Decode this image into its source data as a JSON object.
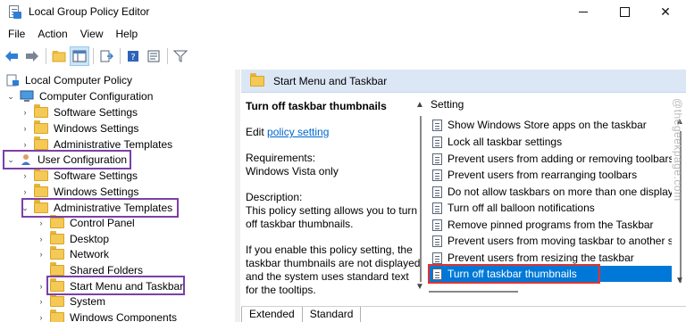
{
  "window": {
    "title": "Local Group Policy Editor",
    "icons": {
      "app": "group-policy-icon",
      "minimize": "minimize-icon",
      "maximize": "maximize-icon",
      "close": "close-icon"
    },
    "close_glyph": "✕"
  },
  "menu": [
    "File",
    "Action",
    "View",
    "Help"
  ],
  "toolbar": {
    "buttons": [
      "back-arrow-icon",
      "forward-arrow-icon",
      "folder-up-icon",
      "show-hide-tree-icon",
      "export-list-icon",
      "help-icon",
      "properties-icon",
      "filter-icon"
    ]
  },
  "tree": {
    "root": "Local Computer Policy",
    "computer_configuration": "Computer Configuration",
    "cc_software": "Software Settings",
    "cc_windows": "Windows Settings",
    "cc_admin": "Administrative Templates",
    "user_configuration": "User Configuration",
    "uc_software": "Software Settings",
    "uc_windows": "Windows Settings",
    "uc_admin": "Administrative Templates",
    "control_panel": "Control Panel",
    "desktop": "Desktop",
    "network": "Network",
    "shared_folders": "Shared Folders",
    "start_menu": "Start Menu and Taskbar",
    "system": "System",
    "windows_components": "Windows Components"
  },
  "right_pane": {
    "header": "Start Menu and Taskbar",
    "policy_title": "Turn off taskbar thumbnails",
    "edit_prefix": "Edit",
    "edit_link": "policy setting",
    "requirements_label": "Requirements:",
    "requirements_value": "Windows Vista only",
    "description_label": "Description:",
    "description_1": "This policy setting allows you to turn off taskbar thumbnails.",
    "description_2": "If you enable this policy setting, the taskbar thumbnails are not displayed and the system uses standard text for the tooltips."
  },
  "settings": {
    "column_header": "Setting",
    "rows": [
      "Show Windows Store apps on the taskbar",
      "Lock all taskbar settings",
      "Prevent users from adding or removing toolbars",
      "Prevent users from rearranging toolbars",
      "Do not allow taskbars on more than one display",
      "Turn off all balloon notifications",
      "Remove pinned programs from the Taskbar",
      "Prevent users from moving taskbar to another screen",
      "Prevent users from resizing the taskbar",
      "Turn off taskbar thumbnails"
    ],
    "selected_index": 9
  },
  "tabs": [
    "Extended",
    "Standard"
  ],
  "watermark": "@thegeekpage.com",
  "colors": {
    "selection": "#0078d7",
    "highlight_purple": "#7b3fa8",
    "highlight_red": "#e0332f",
    "header_bg": "#dce7f5",
    "link": "#0066cc"
  }
}
